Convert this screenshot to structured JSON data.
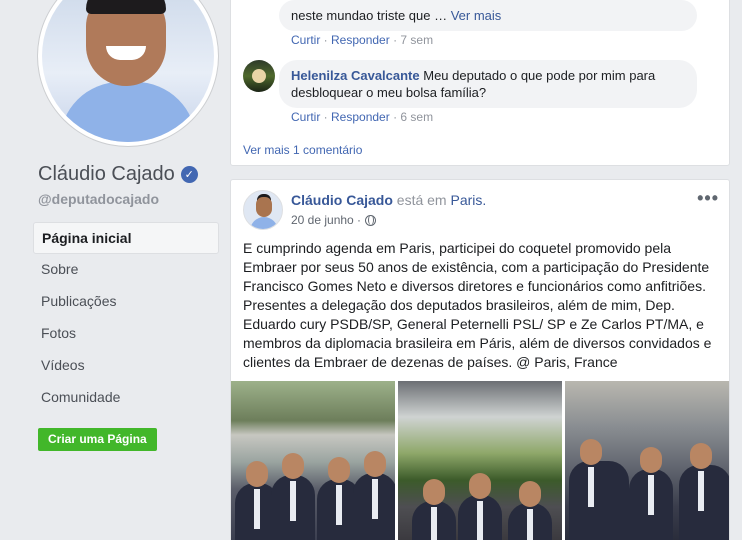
{
  "profile": {
    "name": "Cláudio Cajado",
    "handle": "@deputadocajado"
  },
  "nav": {
    "items": [
      {
        "label": "Página inicial",
        "active": true
      },
      {
        "label": "Sobre"
      },
      {
        "label": "Publicações"
      },
      {
        "label": "Fotos"
      },
      {
        "label": "Vídeos"
      },
      {
        "label": "Comunidade"
      }
    ],
    "create_page": "Criar uma Página"
  },
  "comments": {
    "c1": {
      "text": "neste mundao triste que … ",
      "see_more": "Ver mais",
      "like": "Curtir",
      "reply": "Responder",
      "time": "7 sem"
    },
    "c2": {
      "author": "Helenilza Cavalcante",
      "text": "Meu deputado o que pode por mim para desbloquear o meu bolsa família?",
      "like": "Curtir",
      "reply": "Responder",
      "time": "6 sem"
    },
    "more": "Ver mais 1 comentário"
  },
  "post": {
    "author": "Cláudio Cajado",
    "is_at": " está em ",
    "place": "Paris.",
    "date": "20 de junho · ",
    "menu": "•••",
    "text": "E cumprindo agenda em Paris, participei do coquetel promovido pela Embraer por seus 50 anos de existência, com a participação do Presidente Francisco Gomes Neto e diversos diretores e funcionários como anfitriões. Presentes a delegação dos deputados brasileiros, além de mim, Dep. Eduardo cury PSDB/SP, General Peternelli PSL/ SP e Ze Carlos PT/MA, e membros da diplomacia brasileira em Páris, além de diversos convidados e clientes da Embraer de dezenas de países. @ Paris, France"
  },
  "colors": {
    "link": "#385898",
    "accent": "#4267b2",
    "create_button": "#42b72a",
    "background": "#e9ebee"
  },
  "icons": [
    "verified-badge-icon",
    "globe-icon",
    "more-options-icon"
  ]
}
